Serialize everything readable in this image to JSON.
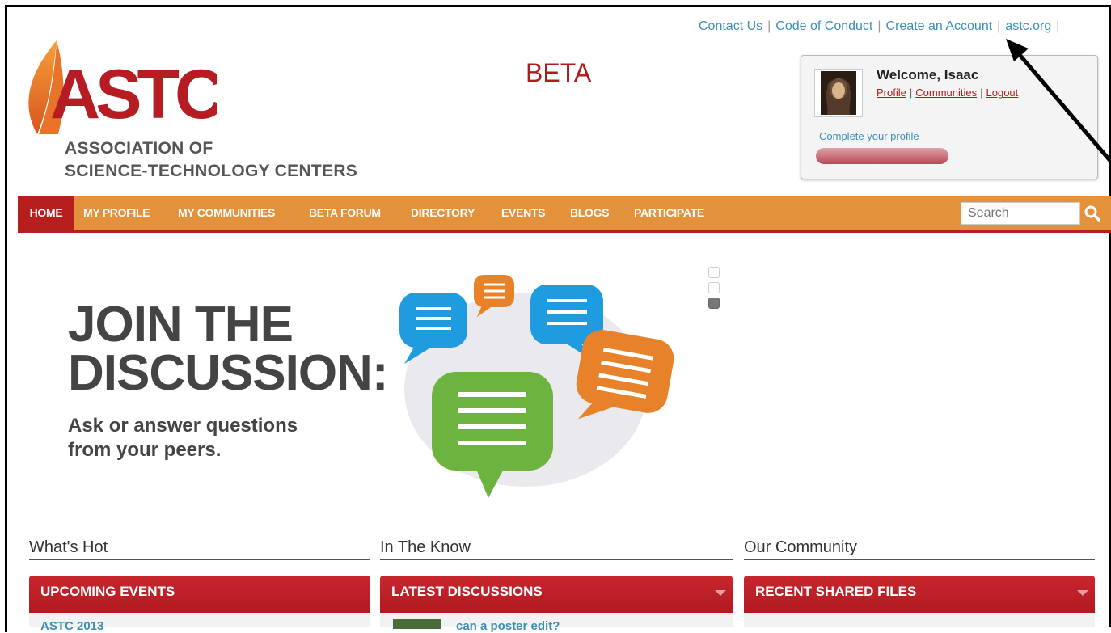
{
  "top_links": [
    {
      "label": "Contact Us"
    },
    {
      "label": "Code of Conduct"
    },
    {
      "label": "Create an Account"
    },
    {
      "label": "astc.org"
    }
  ],
  "logo": {
    "wordmark": "ASTC",
    "line1": "ASSOCIATION OF",
    "line2": "SCIENCE-TECHNOLOGY CENTERS"
  },
  "beta_label": "BETA",
  "welcome": {
    "title": "Welcome, Isaac",
    "links": [
      {
        "label": "Profile"
      },
      {
        "label": "Communities"
      },
      {
        "label": "Logout"
      }
    ],
    "complete_profile": "Complete your profile",
    "progress": 1.0
  },
  "nav": {
    "items": [
      {
        "label": "HOME"
      },
      {
        "label": "MY PROFILE"
      },
      {
        "label": "MY COMMUNITIES"
      },
      {
        "label": "BETA FORUM"
      },
      {
        "label": "DIRECTORY"
      },
      {
        "label": "EVENTS"
      },
      {
        "label": "BLOGS"
      },
      {
        "label": "PARTICIPATE"
      }
    ],
    "search_placeholder": "Search"
  },
  "hero": {
    "title_line1": "JOIN THE",
    "title_line2": "DISCUSSION:",
    "sub_line1": "Ask or answer questions",
    "sub_line2": "from your peers.",
    "slide_count": 3,
    "active_slide": 3
  },
  "sections": [
    {
      "heading": "What's Hot",
      "panel": "UPCOMING EVENTS",
      "item": "ASTC 2013"
    },
    {
      "heading": "In The Know",
      "panel": "LATEST DISCUSSIONS",
      "item": "can a poster edit?"
    },
    {
      "heading": "Our Community",
      "panel": "RECENT SHARED FILES",
      "item": ""
    }
  ],
  "colors": {
    "brand_red": "#b71f1f",
    "nav_orange": "#e3913a",
    "link_blue": "#3c8fb5"
  }
}
